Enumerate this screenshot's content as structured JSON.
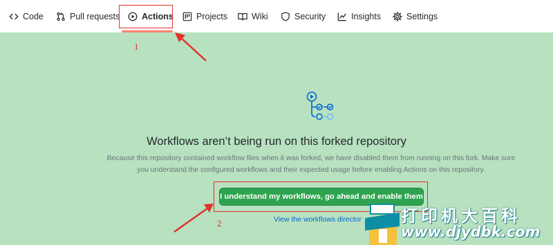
{
  "nav": {
    "items": [
      {
        "label": "Code",
        "icon": "code-icon"
      },
      {
        "label": "Pull requests",
        "icon": "pull-request-icon"
      },
      {
        "label": "Actions",
        "icon": "play-icon",
        "active": true
      },
      {
        "label": "Projects",
        "icon": "project-icon"
      },
      {
        "label": "Wiki",
        "icon": "book-icon"
      },
      {
        "label": "Security",
        "icon": "shield-icon"
      },
      {
        "label": "Insights",
        "icon": "graph-icon"
      },
      {
        "label": "Settings",
        "icon": "gear-icon"
      }
    ]
  },
  "annotations": {
    "step1": "1",
    "step2": "2",
    "color": "#e1322d"
  },
  "blankslate": {
    "title": "Workflows aren’t being run on this forked repository",
    "description": "Because this repository contained workflow files when it was forked, we have disabled them from running on this fork. Make sure you understand the configured workflows and their expected usage before enabling Actions on this repository.",
    "enable_button": "I understand my workflows, go ahead and enable them",
    "view_link": "View the workflows director"
  },
  "watermark": {
    "title": "打印机大百科",
    "url": "www.djydbk.com"
  },
  "colors": {
    "background": "#b7e1bf",
    "button": "#2ea44f",
    "link": "#0366d6",
    "active_underline": "#f9826c"
  }
}
